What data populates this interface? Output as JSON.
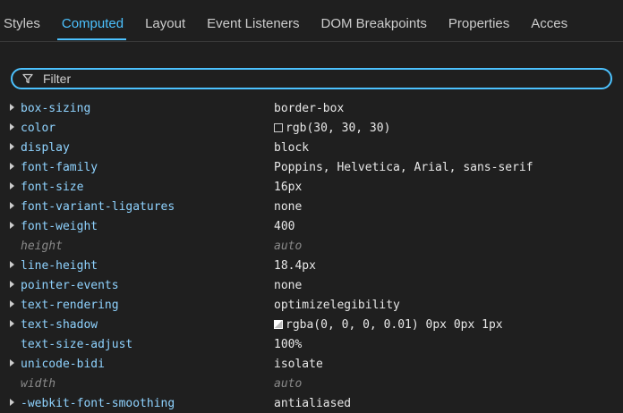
{
  "tabs": [
    {
      "label": "Styles",
      "active": false
    },
    {
      "label": "Computed",
      "active": true
    },
    {
      "label": "Layout",
      "active": false
    },
    {
      "label": "Event Listeners",
      "active": false
    },
    {
      "label": "DOM Breakpoints",
      "active": false
    },
    {
      "label": "Properties",
      "active": false
    },
    {
      "label": "Acces",
      "active": false
    }
  ],
  "filter": {
    "placeholder": "Filter",
    "value": ""
  },
  "properties": [
    {
      "name": "box-sizing",
      "value": "border-box",
      "inherited": false,
      "expandable": true
    },
    {
      "name": "color",
      "value": "rgb(30, 30, 30)",
      "inherited": false,
      "expandable": true,
      "swatch": "#1e1e1e"
    },
    {
      "name": "display",
      "value": "block",
      "inherited": false,
      "expandable": true
    },
    {
      "name": "font-family",
      "value": "Poppins, Helvetica, Arial, sans-serif",
      "inherited": false,
      "expandable": true
    },
    {
      "name": "font-size",
      "value": "16px",
      "inherited": false,
      "expandable": true
    },
    {
      "name": "font-variant-ligatures",
      "value": "none",
      "inherited": false,
      "expandable": true
    },
    {
      "name": "font-weight",
      "value": "400",
      "inherited": false,
      "expandable": true
    },
    {
      "name": "height",
      "value": "auto",
      "inherited": true,
      "expandable": false
    },
    {
      "name": "line-height",
      "value": "18.4px",
      "inherited": false,
      "expandable": true
    },
    {
      "name": "pointer-events",
      "value": "none",
      "inherited": false,
      "expandable": true
    },
    {
      "name": "text-rendering",
      "value": "optimizelegibility",
      "inherited": false,
      "expandable": true
    },
    {
      "name": "text-shadow",
      "value": "rgba(0, 0, 0, 0.01) 0px 0px 1px",
      "inherited": false,
      "expandable": true,
      "swatch": "shadow"
    },
    {
      "name": "text-size-adjust",
      "value": "100%",
      "inherited": false,
      "expandable": false
    },
    {
      "name": "unicode-bidi",
      "value": "isolate",
      "inherited": false,
      "expandable": true
    },
    {
      "name": "width",
      "value": "auto",
      "inherited": true,
      "expandable": false
    },
    {
      "name": "-webkit-font-smoothing",
      "value": "antialiased",
      "inherited": false,
      "expandable": true
    }
  ],
  "colors": {
    "accent": "#4cc2ff",
    "property_name": "#8fd3ff",
    "value_text": "#e8e8e8",
    "inherited_text": "#8a8a8a",
    "background": "#1f1f1f"
  }
}
